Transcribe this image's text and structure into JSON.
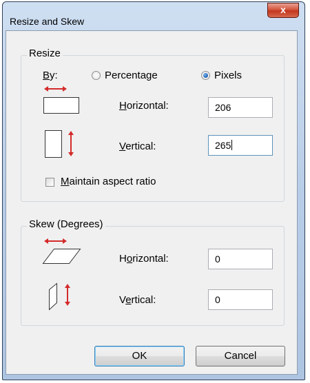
{
  "window": {
    "title": "Resize and Skew",
    "close_label": "x"
  },
  "resize": {
    "group_label": "Resize",
    "by_label": "By:",
    "percentage_label": "Percentage",
    "pixels_label": "Pixels",
    "selected_unit": "Pixels",
    "horizontal_label": "Horizontal:",
    "horizontal_value": "206",
    "vertical_label": "Vertical:",
    "vertical_value": "265",
    "maintain_aspect_label": "Maintain aspect ratio",
    "maintain_aspect_checked": false
  },
  "skew": {
    "group_label": "Skew (Degrees)",
    "horizontal_label": "Horizontal:",
    "horizontal_value": "0",
    "vertical_label": "Vertical:",
    "vertical_value": "0"
  },
  "buttons": {
    "ok_label": "OK",
    "cancel_label": "Cancel"
  },
  "colors": {
    "arrow": "#d42a2a",
    "accent": "#3c7fb1"
  }
}
